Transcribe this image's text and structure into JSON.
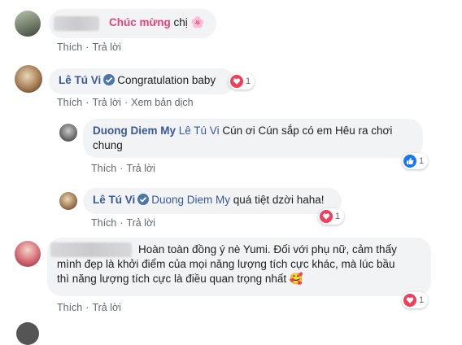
{
  "comments": [
    {
      "name": "",
      "text_highlight": "Chúc mừng",
      "text_rest": " chị",
      "emoji": "🌸",
      "actions": [
        "Thích",
        "Trả lời"
      ]
    },
    {
      "name": "Lê Tú Vi",
      "text": "Congratulation baby",
      "reaction_count": "1",
      "actions": [
        "Thích",
        "Trả lời",
        "Xem bản dịch"
      ]
    },
    {
      "name": "Duong Diem My",
      "tag": "Lê Tú Vi",
      "line1": " Cún ơi Cún sắp có em Hêu ra chơi",
      "line2": "chung",
      "reaction_count": "1",
      "actions": [
        "Thích",
        "Trả lời"
      ]
    },
    {
      "name": "Lê Tú Vi",
      "tag": "Duong Diem My",
      "text": " quá tiệt dzời haha!",
      "reaction_count": "1",
      "actions": [
        "Thích",
        "Trả lời"
      ]
    },
    {
      "line1": "Hoàn toàn đồng ý nè Yumi. Đối với phụ nữ, cảm thấy",
      "line2": "mình đẹp là khởi điểm của mọi năng lượng tích cực khác, mà lúc bầu",
      "line3": "thì năng lượng tích cực là điều quan trọng nhất",
      "emoji": "🥰",
      "reaction_count": "1",
      "actions": [
        "Thích",
        "Trả lời"
      ]
    }
  ],
  "colors": {
    "link": "#385898",
    "bubble": "#f2f3f5",
    "love": "#f33e58",
    "like": "#1877f2",
    "pink": "#e0457b"
  }
}
